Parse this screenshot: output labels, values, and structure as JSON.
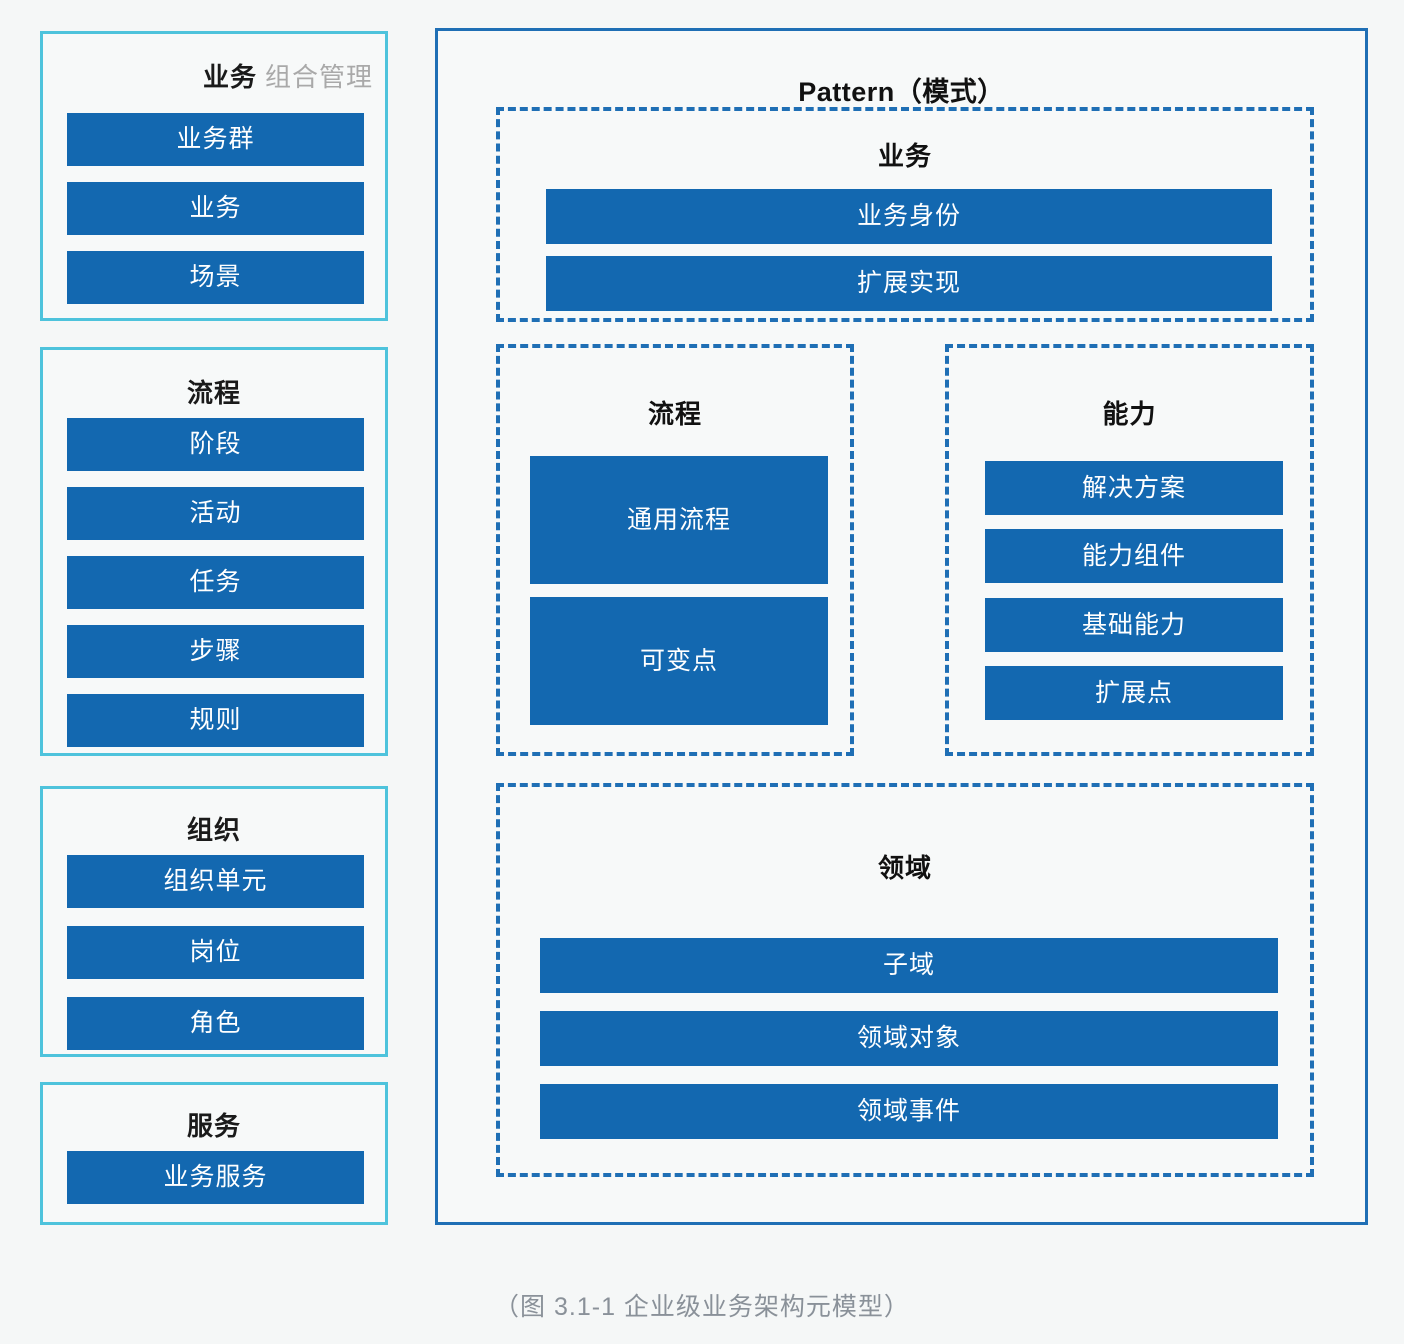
{
  "colors": {
    "background": "#f5f7f7",
    "panel_fill": "#f7f9f9",
    "left_panel_border": "#4ec3dc",
    "right_panel_border": "#1f6fb5",
    "dashed_border": "#1f6fb5",
    "block_fill": "#1368b0",
    "block_text": "#ffffff",
    "title_text": "#1a1a1a",
    "title_sub_text": "#a9a9a9",
    "caption_text": "#8a9199"
  },
  "left_column": {
    "panels": [
      {
        "id": "business-portfolio",
        "title_main": "业务",
        "title_sub": "组合管理",
        "title_align": "right",
        "items": [
          "业务群",
          "业务",
          "场景"
        ]
      },
      {
        "id": "process",
        "title_main": "流程",
        "title_sub": "",
        "title_align": "center",
        "items": [
          "阶段",
          "活动",
          "任务",
          "步骤",
          "规则"
        ]
      },
      {
        "id": "organization",
        "title_main": "组织",
        "title_sub": "",
        "title_align": "center",
        "items": [
          "组织单元",
          "岗位",
          "角色"
        ]
      },
      {
        "id": "service",
        "title_main": "服务",
        "title_sub": "",
        "title_align": "center",
        "items": [
          "业务服务"
        ]
      }
    ]
  },
  "pattern_panel": {
    "title": "Pattern（模式）",
    "groups": [
      {
        "id": "business",
        "title": "业务",
        "items": [
          "业务身份",
          "扩展实现"
        ]
      },
      {
        "id": "process",
        "title": "流程",
        "items": [
          "通用流程",
          "可变点"
        ]
      },
      {
        "id": "capability",
        "title": "能力",
        "items": [
          "解决方案",
          "能力组件",
          "基础能力",
          "扩展点"
        ]
      },
      {
        "id": "domain",
        "title": "领域",
        "items": [
          "子域",
          "领域对象",
          "领域事件"
        ]
      }
    ]
  },
  "caption": "（图 3.1-1 企业级业务架构元模型）"
}
